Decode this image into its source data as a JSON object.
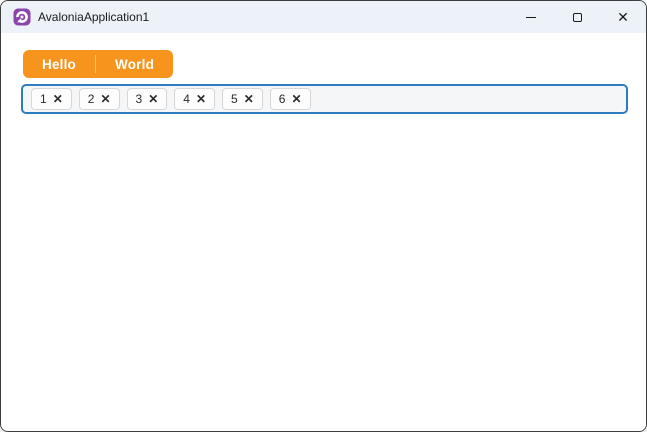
{
  "window": {
    "title": "AvaloniaApplication1",
    "controls": {
      "close_glyph": "✕"
    }
  },
  "tab_strip": {
    "selected": "Hello",
    "tabs": [
      {
        "label": "Hello"
      },
      {
        "label": "World"
      }
    ]
  },
  "chip_box": {
    "chips": [
      {
        "label": "1",
        "close_glyph": "✕"
      },
      {
        "label": "2",
        "close_glyph": "✕"
      },
      {
        "label": "3",
        "close_glyph": "✕"
      },
      {
        "label": "4",
        "close_glyph": "✕"
      },
      {
        "label": "5",
        "close_glyph": "✕"
      },
      {
        "label": "6",
        "close_glyph": "✕"
      }
    ]
  },
  "colors": {
    "accent_orange": "#F7941E",
    "chipbox_border": "#2E7CC0",
    "titlebar_bg": "#EDF2F8",
    "window_frame": "#3D3D3D",
    "avalonia_purple": "#8B44AC"
  }
}
